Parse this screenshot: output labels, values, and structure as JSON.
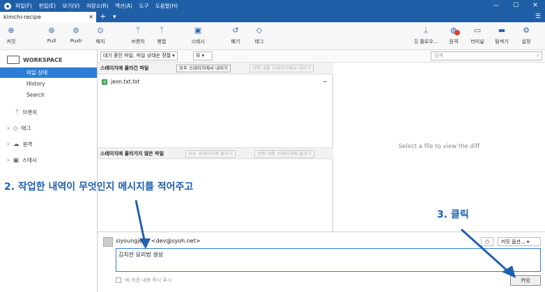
{
  "titlebar": {
    "menus": [
      "파일(F)",
      "편집(E)",
      "보기(V)",
      "저장소(R)",
      "액션(A)",
      "도구",
      "도움말(H)"
    ],
    "controls": [
      "—",
      "☐",
      "✕"
    ]
  },
  "tabbar": {
    "tab_name": "kimchi-recipe",
    "close": "✕",
    "plus": "+",
    "drop": "▼",
    "menu": "☰"
  },
  "toolbar": {
    "commit": "커밋",
    "pull": "Pull",
    "push": "Push",
    "fetch": "패치",
    "branch": "브랜치",
    "merge": "병합",
    "stash": "스태시",
    "discard": "폐기",
    "tag": "태그",
    "gitflow": "깃 플로우...",
    "remote": "원격",
    "terminal": "터미널",
    "explorer": "탐색기",
    "settings": "설정"
  },
  "sidebar": {
    "workspace": "WORKSPACE",
    "items": [
      "파일 상태",
      "History",
      "Search"
    ],
    "groups": [
      "브랜치",
      "태그",
      "원격",
      "스태시"
    ]
  },
  "filterbar": {
    "filter": "대기 중인 파일, 파일 상태순 정렬 ▾",
    "view": "☰ ▾",
    "search_placeholder": "검색"
  },
  "staged": {
    "title": "스테이지에 올라간 파일",
    "unstage_all": "모두 스테이지에서 내리기",
    "unstage_selected": "선택 내용 스테이지에서 내리기",
    "files": [
      "jeon.txt.txt"
    ]
  },
  "unstaged": {
    "title": "스테이지에 올라가지 않은 파일",
    "stage_all": "모두 스테이지에 올리기",
    "stage_selected": "선택 내용 스테이지에 올리기"
  },
  "diff": {
    "placeholder": "Select a file to view the diff"
  },
  "annotations": {
    "step2": "2. 작업한 내역이 무엇인지 메시지를 적어주고",
    "step3": "3. 클릭"
  },
  "commit": {
    "author": "siyoungjeon <dev@syoh.net>",
    "message": "김치전 요리법 생성",
    "options": "커밋 옵션... ▾",
    "push_immediately": "-에 바뀐 내용 즉시 푸시",
    "button": "커밋"
  },
  "colors": {
    "titlebar": "#1f5fa8",
    "selection": "#2c7ed6",
    "annotation": "#1e5fb0"
  }
}
